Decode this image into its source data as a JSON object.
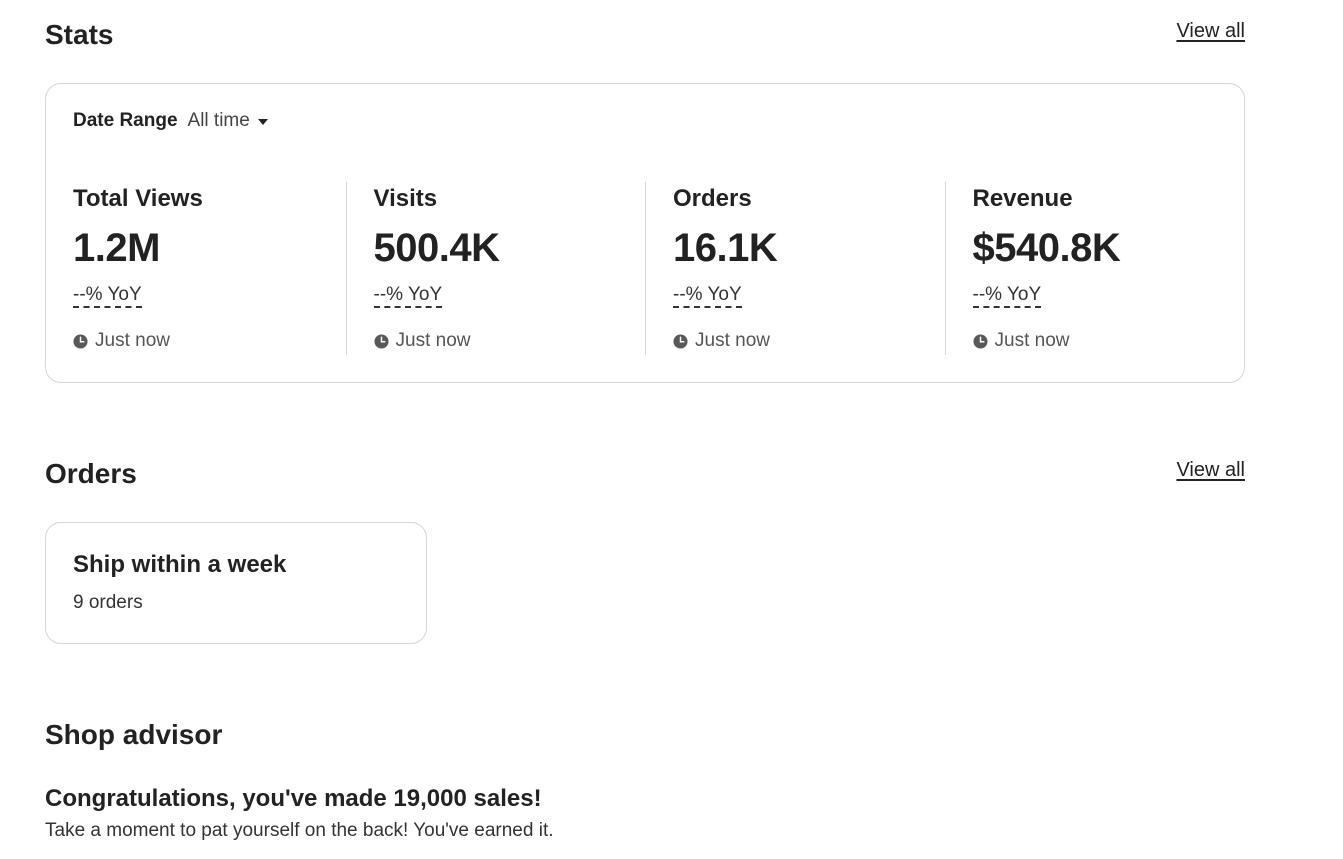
{
  "stats": {
    "title": "Stats",
    "view_all_label": "View all",
    "date_range": {
      "label": "Date Range",
      "value": "All time"
    },
    "metrics": [
      {
        "name": "Total Views",
        "value": "1.2M",
        "yoy": "--% YoY",
        "updated": "Just now"
      },
      {
        "name": "Visits",
        "value": "500.4K",
        "yoy": "--% YoY",
        "updated": "Just now"
      },
      {
        "name": "Orders",
        "value": "16.1K",
        "yoy": "--% YoY",
        "updated": "Just now"
      },
      {
        "name": "Revenue",
        "value": "$540.8K",
        "yoy": "--% YoY",
        "updated": "Just now"
      }
    ]
  },
  "orders": {
    "title": "Orders",
    "view_all_label": "View all",
    "card": {
      "title": "Ship within a week",
      "count": "9 orders"
    }
  },
  "shop_advisor": {
    "title": "Shop advisor",
    "message_title": "Congratulations, you've made 19,000 sales!",
    "message_text": "Take a moment to pat yourself on the back! You've earned it."
  },
  "icons": {
    "clock": "clock-icon",
    "caret": "caret-down-icon"
  },
  "colors": {
    "text": "#222222",
    "border": "#d6d6d6",
    "muted": "#555555"
  }
}
